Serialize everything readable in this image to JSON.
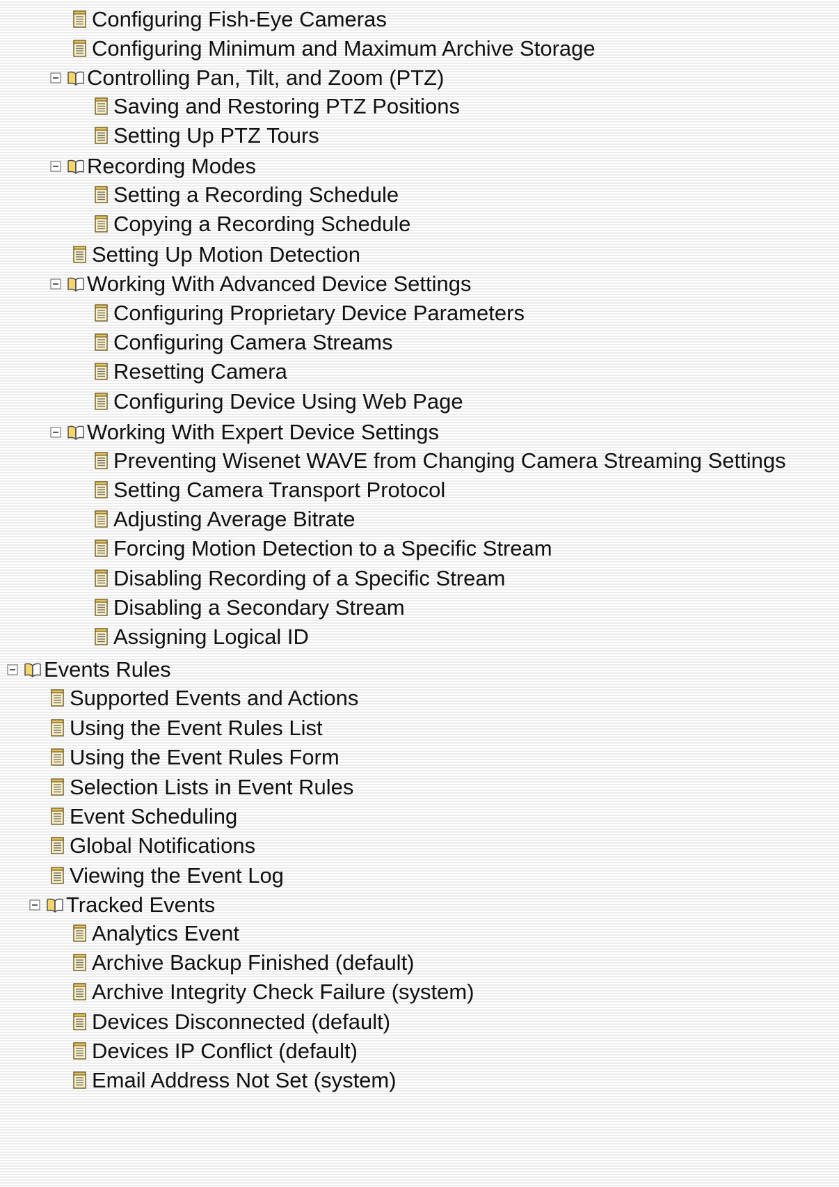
{
  "tree": {
    "items": [
      {
        "label": "Configuring Fish-Eye Cameras",
        "kind": "page",
        "level": 3,
        "expanded": null
      },
      {
        "label": "Configuring Minimum and Maximum Archive Storage",
        "kind": "page",
        "level": 3,
        "expanded": null
      },
      {
        "label": "Controlling Pan, Tilt, and Zoom (PTZ)",
        "kind": "book",
        "level": 2,
        "expanded": true
      },
      {
        "label": "Saving and Restoring PTZ Positions",
        "kind": "page",
        "level": 4,
        "expanded": null
      },
      {
        "label": "Setting Up PTZ Tours",
        "kind": "page",
        "level": 4,
        "expanded": null
      },
      {
        "label": "Recording Modes",
        "kind": "book",
        "level": 2,
        "expanded": true
      },
      {
        "label": "Setting a Recording Schedule",
        "kind": "page",
        "level": 4,
        "expanded": null
      },
      {
        "label": "Copying a Recording Schedule",
        "kind": "page",
        "level": 4,
        "expanded": null
      },
      {
        "label": "Setting Up Motion Detection",
        "kind": "page",
        "level": 3,
        "expanded": null
      },
      {
        "label": "Working With Advanced Device Settings",
        "kind": "book",
        "level": 2,
        "expanded": true
      },
      {
        "label": "Configuring Proprietary Device Parameters",
        "kind": "page",
        "level": 4,
        "expanded": null
      },
      {
        "label": "Configuring Camera Streams",
        "kind": "page",
        "level": 4,
        "expanded": null
      },
      {
        "label": "Resetting Camera",
        "kind": "page",
        "level": 4,
        "expanded": null
      },
      {
        "label": "Configuring Device Using Web Page",
        "kind": "page",
        "level": 4,
        "expanded": null
      },
      {
        "label": "Working With Expert Device Settings",
        "kind": "book",
        "level": 2,
        "expanded": true
      },
      {
        "label": "Preventing Wisenet WAVE from Changing Camera Streaming Settings",
        "kind": "page",
        "level": 4,
        "expanded": null
      },
      {
        "label": "Setting Camera Transport Protocol",
        "kind": "page",
        "level": 4,
        "expanded": null
      },
      {
        "label": "Adjusting Average Bitrate",
        "kind": "page",
        "level": 4,
        "expanded": null
      },
      {
        "label": "Forcing Motion Detection to a Specific Stream",
        "kind": "page",
        "level": 4,
        "expanded": null
      },
      {
        "label": "Disabling Recording of a Specific Stream",
        "kind": "page",
        "level": 4,
        "expanded": null
      },
      {
        "label": "Disabling a Secondary Stream",
        "kind": "page",
        "level": 4,
        "expanded": null
      },
      {
        "label": "Assigning Logical ID",
        "kind": "page",
        "level": 4,
        "expanded": null
      },
      {
        "label": "Events Rules",
        "kind": "book",
        "level": 0,
        "expanded": true
      },
      {
        "label": "Supported Events and Actions",
        "kind": "page",
        "level": 2,
        "expanded": null
      },
      {
        "label": "Using the Event Rules List",
        "kind": "page",
        "level": 2,
        "expanded": null
      },
      {
        "label": "Using the Event Rules Form",
        "kind": "page",
        "level": 2,
        "expanded": null
      },
      {
        "label": "Selection Lists in Event Rules",
        "kind": "page",
        "level": 2,
        "expanded": null
      },
      {
        "label": "Event Scheduling",
        "kind": "page",
        "level": 2,
        "expanded": null
      },
      {
        "label": "Global Notifications",
        "kind": "page",
        "level": 2,
        "expanded": null
      },
      {
        "label": "Viewing the Event Log",
        "kind": "page",
        "level": 2,
        "expanded": null
      },
      {
        "label": "Tracked Events",
        "kind": "book",
        "level": 1,
        "expanded": true
      },
      {
        "label": "Analytics Event",
        "kind": "page",
        "level": 3,
        "expanded": null
      },
      {
        "label": "Archive Backup Finished (default)",
        "kind": "page",
        "level": 3,
        "expanded": null
      },
      {
        "label": "Archive Integrity Check Failure (system)",
        "kind": "page",
        "level": 3,
        "expanded": null
      },
      {
        "label": "Devices Disconnected (default)",
        "kind": "page",
        "level": 3,
        "expanded": null
      },
      {
        "label": "Devices IP Conflict (default)",
        "kind": "page",
        "level": 3,
        "expanded": null
      },
      {
        "label": "Email Address Not Set (system)",
        "kind": "page",
        "level": 3,
        "expanded": null
      }
    ]
  },
  "icons": {
    "page": "page-icon",
    "book": "open-book-icon",
    "toggle": "collapse-minus-icon"
  },
  "colors": {
    "text": "#111111",
    "stripe_light": "#ffffff",
    "stripe_dark": "#ececec",
    "page_icon_paper": "#fbf1c5",
    "page_icon_border": "#6b5a2a",
    "book_icon_fill": "#f5d66b",
    "toggle_border": "#7a7a7a"
  }
}
